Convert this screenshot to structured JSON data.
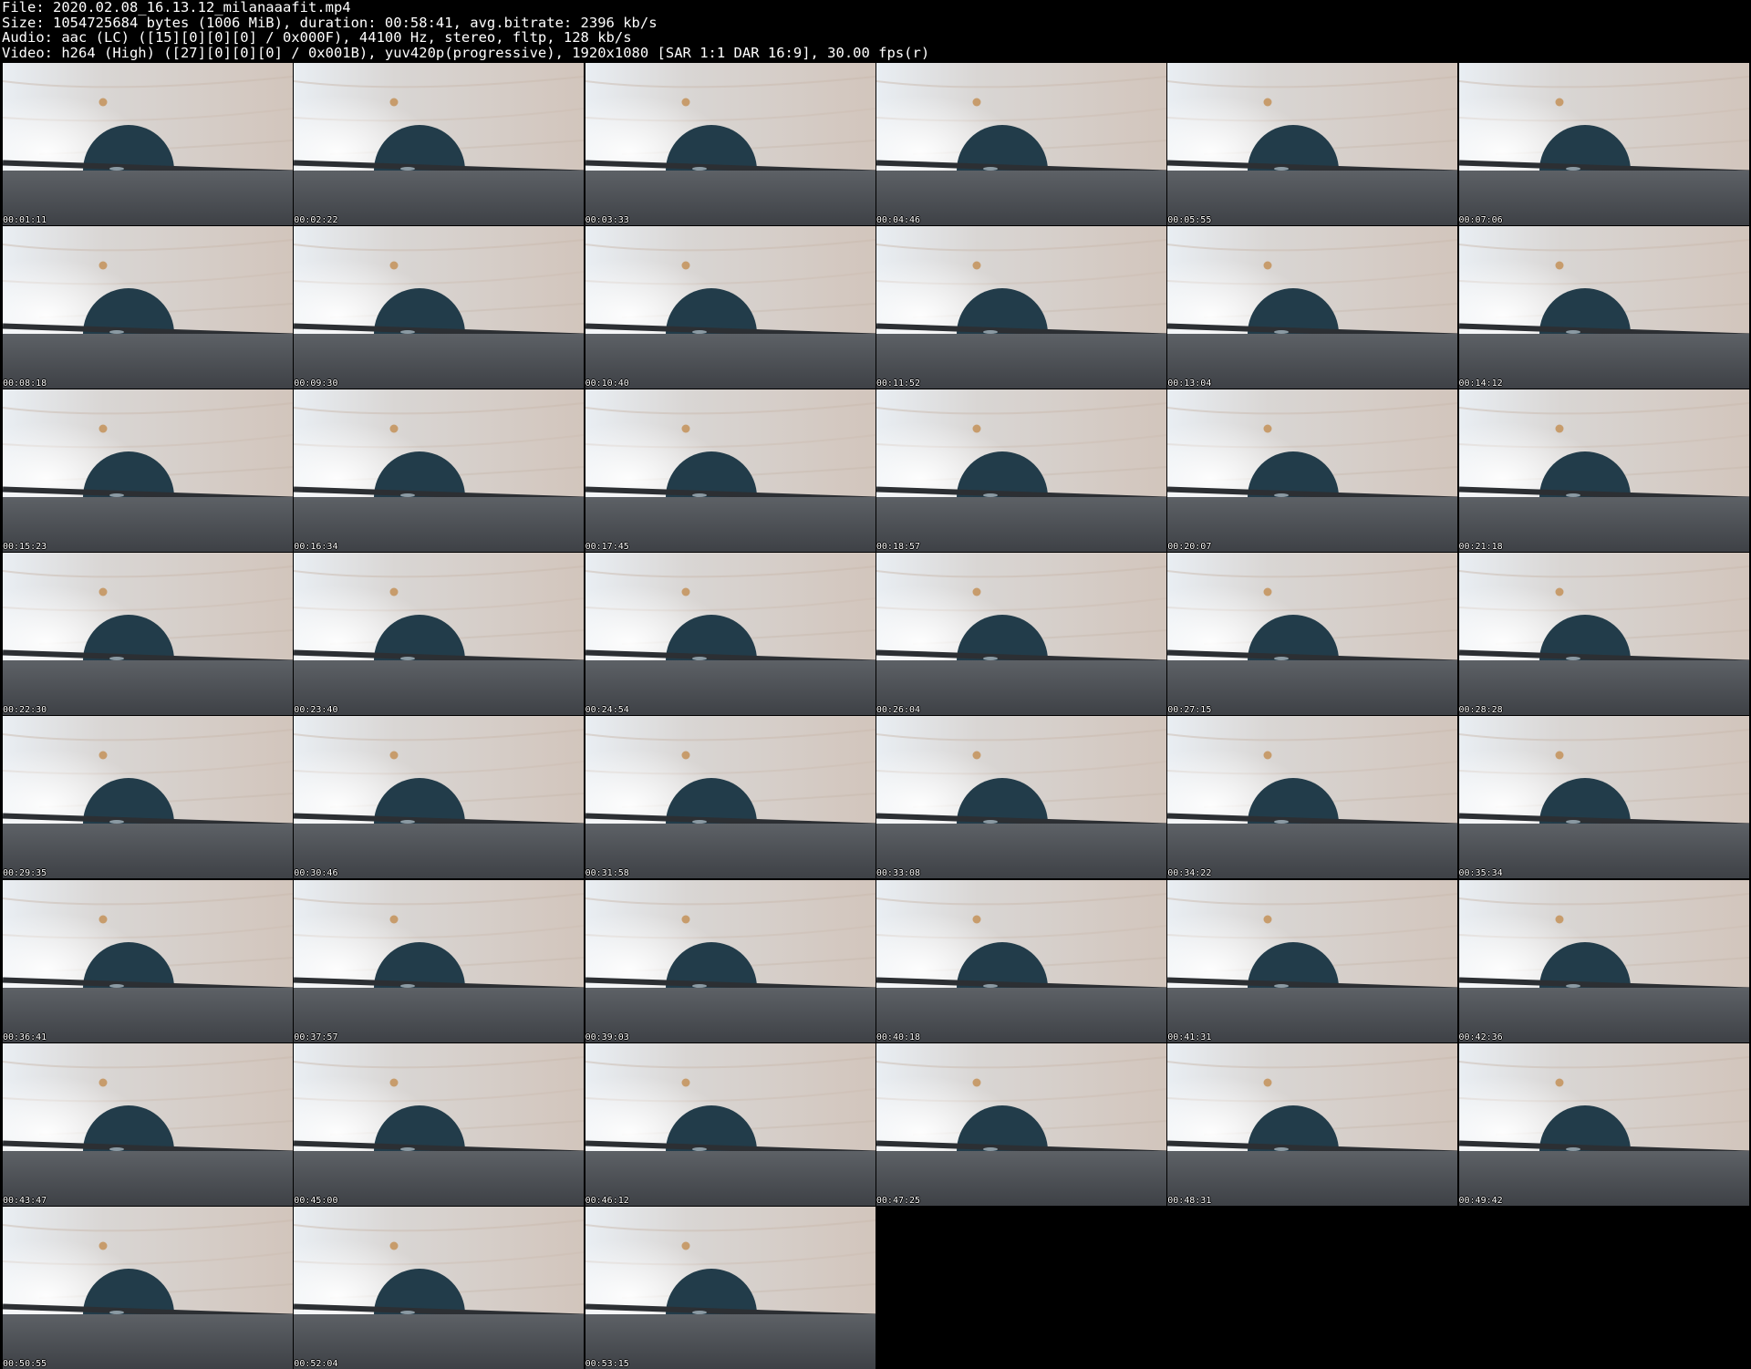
{
  "header": {
    "file_line": "File: 2020.02.08_16.13.12_milanaaafit.mp4",
    "size_line": "Size: 1054725684 bytes (1006 MiB), duration: 00:58:41, avg.bitrate: 2396 kb/s",
    "audio_line": "Audio: aac (LC) ([15][0][0][0] / 0x000F), 44100 Hz, stereo, fltp, 128 kb/s",
    "video_line": "Video: h264 (High) ([27][0][0][0] / 0x001B), yuv420p(progressive), 1920x1080 [SAR 1:1 DAR 16:9], 30.00 fps(r)"
  },
  "thumbnails": [
    {
      "timestamp": "00:01:11"
    },
    {
      "timestamp": "00:02:22"
    },
    {
      "timestamp": "00:03:33"
    },
    {
      "timestamp": "00:04:46"
    },
    {
      "timestamp": "00:05:55"
    },
    {
      "timestamp": "00:07:06"
    },
    {
      "timestamp": "00:08:18"
    },
    {
      "timestamp": "00:09:30"
    },
    {
      "timestamp": "00:10:40"
    },
    {
      "timestamp": "00:11:52"
    },
    {
      "timestamp": "00:13:04"
    },
    {
      "timestamp": "00:14:12"
    },
    {
      "timestamp": "00:15:23"
    },
    {
      "timestamp": "00:16:34"
    },
    {
      "timestamp": "00:17:45"
    },
    {
      "timestamp": "00:18:57"
    },
    {
      "timestamp": "00:20:07"
    },
    {
      "timestamp": "00:21:18"
    },
    {
      "timestamp": "00:22:30"
    },
    {
      "timestamp": "00:23:40"
    },
    {
      "timestamp": "00:24:54"
    },
    {
      "timestamp": "00:26:04"
    },
    {
      "timestamp": "00:27:15"
    },
    {
      "timestamp": "00:28:28"
    },
    {
      "timestamp": "00:29:35"
    },
    {
      "timestamp": "00:30:46"
    },
    {
      "timestamp": "00:31:58"
    },
    {
      "timestamp": "00:33:08"
    },
    {
      "timestamp": "00:34:22"
    },
    {
      "timestamp": "00:35:34"
    },
    {
      "timestamp": "00:36:41"
    },
    {
      "timestamp": "00:37:57"
    },
    {
      "timestamp": "00:39:03"
    },
    {
      "timestamp": "00:40:18"
    },
    {
      "timestamp": "00:41:31"
    },
    {
      "timestamp": "00:42:36"
    },
    {
      "timestamp": "00:43:47"
    },
    {
      "timestamp": "00:45:00"
    },
    {
      "timestamp": "00:46:12"
    },
    {
      "timestamp": "00:47:25"
    },
    {
      "timestamp": "00:48:31"
    },
    {
      "timestamp": "00:49:42"
    },
    {
      "timestamp": "00:50:55"
    },
    {
      "timestamp": "00:52:04"
    },
    {
      "timestamp": "00:53:15"
    }
  ]
}
